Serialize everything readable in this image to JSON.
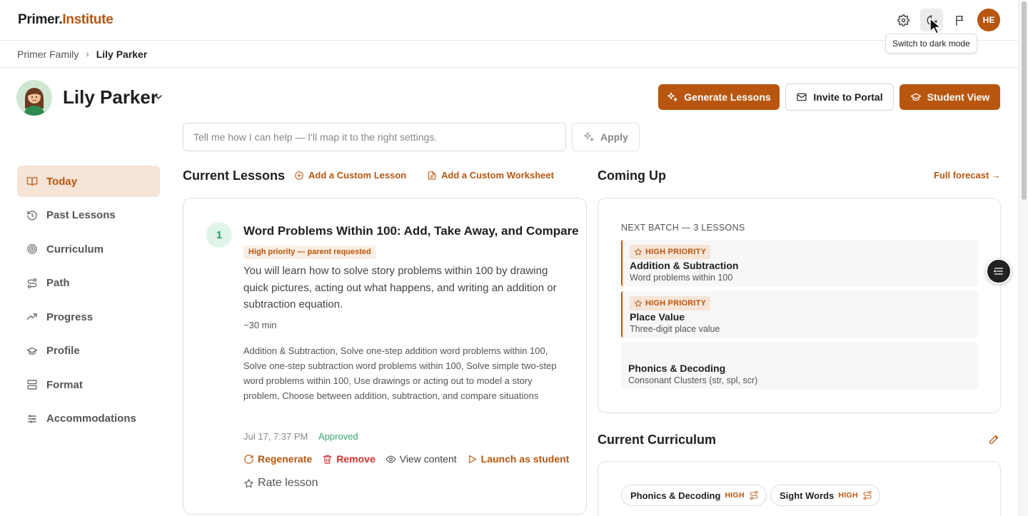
{
  "header": {
    "logo_part1": "Primer.",
    "logo_part2": "Institute",
    "icons": [
      "gear-icon",
      "moon-icon",
      "flag-icon"
    ],
    "avatar_initials": "HE",
    "tooltip": "Switch to dark mode"
  },
  "breadcrumb": {
    "parent": "Primer Family",
    "current": "Lily Parker"
  },
  "student": {
    "name": "Lily Parker"
  },
  "actions": {
    "generate": "Generate Lessons",
    "invite": "Invite to Portal",
    "student_view": "Student View"
  },
  "help": {
    "placeholder": "Tell me how I can help — I'll map it to the right settings.",
    "apply": "Apply"
  },
  "sidebar": {
    "items": [
      {
        "label": "Today",
        "icon": "book-icon",
        "active": true
      },
      {
        "label": "Past Lessons",
        "icon": "history-icon"
      },
      {
        "label": "Curriculum",
        "icon": "target-icon"
      },
      {
        "label": "Path",
        "icon": "route-icon"
      },
      {
        "label": "Progress",
        "icon": "trending-icon"
      },
      {
        "label": "Profile",
        "icon": "graduation-cap-icon"
      },
      {
        "label": "Format",
        "icon": "layout-icon"
      },
      {
        "label": "Accommodations",
        "icon": "sliders-icon"
      }
    ]
  },
  "current_lessons": {
    "title": "Current Lessons",
    "add_lesson": "Add a Custom Lesson",
    "add_worksheet": "Add a Custom Worksheet",
    "lesson": {
      "number": "1",
      "title": "Word Problems Within 100: Add, Take Away, and Compare",
      "priority": "High priority — parent requested",
      "description": "You will learn how to solve story problems within 100 by drawing quick pictures, acting out what happens, and writing an addition or subtraction equation.",
      "duration": "~30 min",
      "skills": "Addition & Subtraction, Solve one-step addition word problems within 100, Solve one-step subtraction word problems within 100, Solve simple two-step word problems within 100, Use drawings or acting out to model a story problem, Choose between addition, subtraction, and compare situations",
      "date": "Jul 17, 7:37 PM",
      "status": "Approved",
      "regenerate": "Regenerate",
      "remove": "Remove",
      "view": "View content",
      "launch": "Launch as student",
      "rate": "Rate lesson"
    }
  },
  "coming_up": {
    "title": "Coming Up",
    "forecast": "Full forecast →",
    "batch_label": "NEXT BATCH — 3 LESSONS",
    "items": [
      {
        "badge": "HIGH PRIORITY",
        "title": "Addition & Subtraction",
        "subtitle": "Word problems within 100"
      },
      {
        "badge": "HIGH PRIORITY",
        "title": "Place Value",
        "subtitle": "Three-digit place value"
      },
      {
        "title": "Phonics & Decoding",
        "subtitle": "Consonant Clusters (str, spl, scr)"
      }
    ]
  },
  "curriculum": {
    "title": "Current Curriculum",
    "chips": [
      {
        "label": "Phonics & Decoding",
        "level": "HIGH"
      },
      {
        "label": "Sight Words",
        "level": "HIGH"
      }
    ]
  },
  "colors": {
    "accent": "#b8560f",
    "accent_light": "#f6e4d7",
    "approved": "#3aa46b",
    "danger": "#d1302c"
  }
}
